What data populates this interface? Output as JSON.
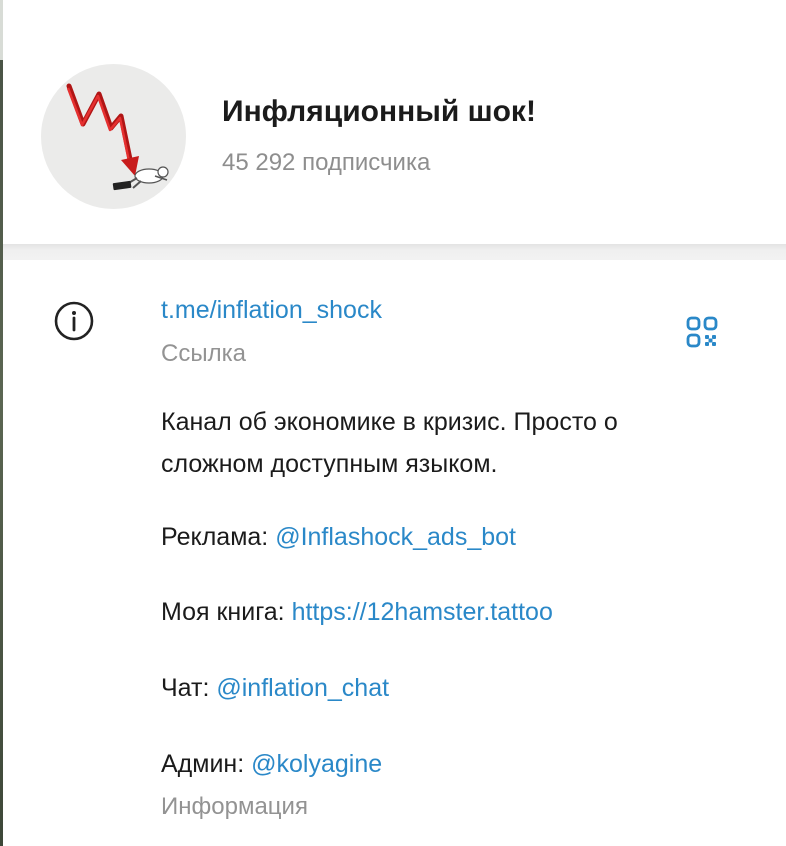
{
  "channel": {
    "title": "Инфляционный шок!",
    "subscribers": "45 292 подписчика",
    "avatar_icon": "falling-chart-avatar"
  },
  "info": {
    "link": "t.me/inflation_shock",
    "link_label": "Ссылка",
    "description_line1": "Канал об экономике в кризис. Просто о",
    "description_line2": "сложном доступным языком.",
    "ads_prefix": "Реклама: ",
    "ads_link": "@Inflashock_ads_bot",
    "book_prefix": "Моя книга: ",
    "book_link": "https://12hamster.tattoo",
    "chat_prefix": "Чат: ",
    "chat_link": "@inflation_chat",
    "admin_prefix": "Админ: ",
    "admin_link": "@kolyagine",
    "info_label": "Информация"
  },
  "colors": {
    "link": "#2a88c8",
    "text": "#1b1b1b",
    "muted": "#939393"
  }
}
